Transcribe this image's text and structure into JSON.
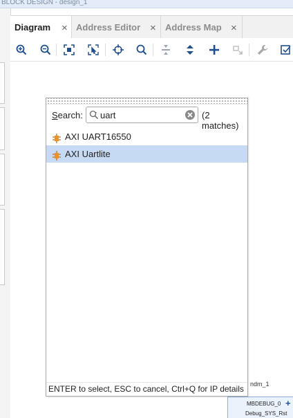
{
  "window": {
    "title_strip_text": "BLOCK DESIGN - design_1"
  },
  "tabs": [
    {
      "label": "Diagram",
      "active": true
    },
    {
      "label": "Address Editor",
      "active": false
    },
    {
      "label": "Address Map",
      "active": false
    }
  ],
  "toolbar": {
    "buttons": [
      "zoom-in-icon",
      "zoom-out-icon",
      "fit-view-icon",
      "fit-selection-icon",
      "crosshair-icon",
      "search-icon",
      "collapse-icon",
      "expand-icon",
      "add-ip-icon",
      "connect-icon",
      "wrench-icon",
      "validate-icon"
    ]
  },
  "search": {
    "label": "Search:",
    "label_accel": "S",
    "label_rest": "earch:",
    "value": "uart",
    "match_count": "(2 matches)"
  },
  "results": [
    {
      "label": "AXI UART16550",
      "selected": false
    },
    {
      "label": "AXI Uartlite",
      "selected": true
    }
  ],
  "footer": {
    "hint": "ENTER to select, ESC to cancel, Ctrl+Q for IP details"
  },
  "canvas": {
    "ndm_label": "ndm_1",
    "port_label": "MBDEBUG_0",
    "signal_label": "Debug_SYS_Rst"
  },
  "colors": {
    "selection": "#c7daf3",
    "accent_blue": "#1f4e8c",
    "ip_icon": "#e8922b"
  }
}
